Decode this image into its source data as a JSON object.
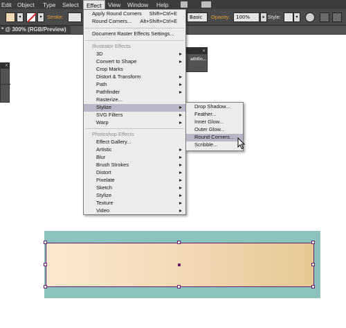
{
  "menubar": {
    "items": [
      "Edit",
      "Object",
      "Type",
      "Select",
      "Effect",
      "View",
      "Window",
      "Help"
    ],
    "active": "Effect"
  },
  "controlbar": {
    "stroke_label": "Stroke:",
    "style_preset": "Basic",
    "opacity_label": "Opacity:",
    "opacity_value": "100%",
    "style_label": "Style:"
  },
  "document": {
    "tab_title": "* @ 300% (RGB/Preview)"
  },
  "panels": {
    "pathfinder_tab": "athfin...",
    "close_glyph": "×"
  },
  "effect_menu": {
    "top_items": [
      {
        "label": "Apply Round Corners",
        "shortcut": "Shift+Ctrl+E"
      },
      {
        "label": "Round Corners...",
        "shortcut": "Alt+Shift+Ctrl+E"
      }
    ],
    "document_settings": "Document Raster Effects Settings...",
    "illustrator_header": "Illustrator Effects",
    "illustrator_items": [
      {
        "label": "3D",
        "submenu": true
      },
      {
        "label": "Convert to Shape",
        "submenu": true
      },
      {
        "label": "Crop Marks",
        "submenu": false
      },
      {
        "label": "Distort & Transform",
        "submenu": true
      },
      {
        "label": "Path",
        "submenu": true
      },
      {
        "label": "Pathfinder",
        "submenu": true
      },
      {
        "label": "Rasterize...",
        "submenu": false
      },
      {
        "label": "Stylize",
        "submenu": true,
        "highlighted": true
      },
      {
        "label": "SVG Filters",
        "submenu": true
      },
      {
        "label": "Warp",
        "submenu": true
      }
    ],
    "photoshop_header": "Photoshop Effects",
    "photoshop_items": [
      {
        "label": "Effect Gallery...",
        "submenu": false
      },
      {
        "label": "Artistic",
        "submenu": true
      },
      {
        "label": "Blur",
        "submenu": true
      },
      {
        "label": "Brush Strokes",
        "submenu": true
      },
      {
        "label": "Distort",
        "submenu": true
      },
      {
        "label": "Pixelate",
        "submenu": true
      },
      {
        "label": "Sketch",
        "submenu": true
      },
      {
        "label": "Stylize",
        "submenu": true
      },
      {
        "label": "Texture",
        "submenu": true
      },
      {
        "label": "Video",
        "submenu": true
      }
    ]
  },
  "stylize_submenu": {
    "items": [
      {
        "label": "Drop Shadow..."
      },
      {
        "label": "Feather..."
      },
      {
        "label": "Inner Glow..."
      },
      {
        "label": "Outer Glow..."
      },
      {
        "label": "Round Corners...",
        "highlighted": true
      },
      {
        "label": "Scribble..."
      }
    ]
  },
  "colors": {
    "selection": "#6b1a6b",
    "menu_highlight": "#b7b7c8",
    "artboard_teal": "#8cc2bd",
    "gradient_start": "#fae8cf",
    "gradient_end": "#e6c894"
  }
}
